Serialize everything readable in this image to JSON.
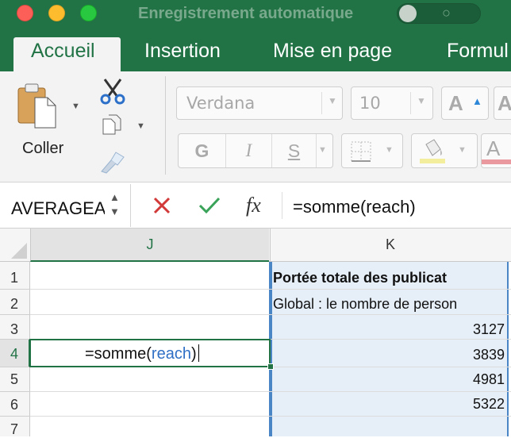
{
  "titlebar": {
    "autosave_label": "Enregistrement automatique",
    "autosave_state": "off",
    "autosave_toggle_text": "○"
  },
  "tabs": [
    "Accueil",
    "Insertion",
    "Mise en page",
    "Formul"
  ],
  "active_tab": "Accueil",
  "ribbon": {
    "paste_label": "Coller",
    "font_name": "Verdana",
    "font_size": "10",
    "grow_font": "A",
    "shrink_font": "A",
    "bold": "G",
    "italic": "I",
    "underline": "S",
    "font_color_glyph": "A",
    "icons": [
      "paste-icon",
      "scissors-icon",
      "copy-icon",
      "format-painter-icon",
      "border-icon",
      "fill-color-icon",
      "font-color-icon"
    ],
    "accent_color": "#217346"
  },
  "formula_bar": {
    "name_box": "AVERAGEA",
    "fx": "fx",
    "formula": "=somme(reach)"
  },
  "grid": {
    "columns": [
      "J",
      "K"
    ],
    "rows": [
      "1",
      "2",
      "3",
      "4",
      "5",
      "6",
      "7"
    ],
    "active_cell": "J4",
    "editing": {
      "prefix": "=somme(",
      "ref": "reach",
      "suffix": ")"
    },
    "column_k": {
      "r1": "Portée totale des publicat",
      "r2": "Global : le nombre de person",
      "r3": "3127",
      "r4": "3839",
      "r5": "4981",
      "r6": "5322"
    }
  }
}
